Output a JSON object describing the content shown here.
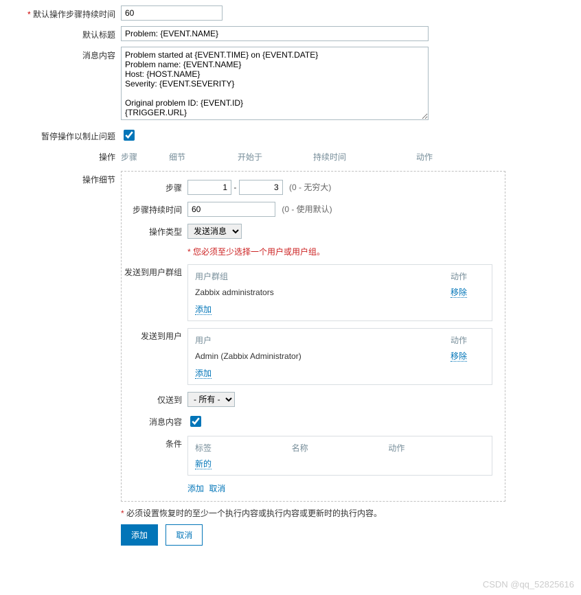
{
  "form": {
    "default_duration": {
      "label": "默认操作步骤持续时间",
      "value": "60"
    },
    "default_title": {
      "label": "默认标题",
      "value": "Problem: {EVENT.NAME}"
    },
    "message": {
      "label": "消息内容",
      "value": "Problem started at {EVENT.TIME} on {EVENT.DATE}\nProblem name: {EVENT.NAME}\nHost: {HOST.NAME}\nSeverity: {EVENT.SEVERITY}\n\nOriginal problem ID: {EVENT.ID}\n{TRIGGER.URL}"
    },
    "pause": {
      "label": "暂停操作以制止问题",
      "checked": true
    },
    "operations": {
      "label": "操作",
      "headers": {
        "step": "步骤",
        "detail": "细节",
        "start": "开始于",
        "duration": "持续时间",
        "action": "动作"
      }
    }
  },
  "details": {
    "label": "操作细节",
    "steps": {
      "label": "步骤",
      "from": "1",
      "to": "3",
      "hint": "(0 - 无穷大)"
    },
    "step_duration": {
      "label": "步骤持续时间",
      "value": "60",
      "hint": "(0 - 使用默认)"
    },
    "op_type": {
      "label": "操作类型",
      "value": "发送消息"
    },
    "validation": "您必须至少选择一个用户或用户组。",
    "user_groups": {
      "label": "发送到用户群组",
      "header_name": "用户群组",
      "header_action": "动作",
      "rows": [
        {
          "name": "Zabbix administrators",
          "action": "移除"
        }
      ],
      "add": "添加"
    },
    "users": {
      "label": "发送到用户",
      "header_name": "用户",
      "header_action": "动作",
      "rows": [
        {
          "name": "Admin (Zabbix Administrator)",
          "action": "移除"
        }
      ],
      "add": "添加"
    },
    "send_only": {
      "label": "仅送到",
      "value": "- 所有 -"
    },
    "msg_content": {
      "label": "消息内容",
      "checked": true
    },
    "conditions": {
      "label": "条件",
      "header_tag": "标签",
      "header_name": "名称",
      "header_action": "动作",
      "new": "新的"
    },
    "footer": {
      "add": "添加",
      "cancel": "取消"
    }
  },
  "recovery_note": "必须设置恢复时的至少一个执行内容或执行内容或更新时的执行内容。",
  "buttons": {
    "add": "添加",
    "cancel": "取消"
  },
  "watermark": "CSDN @qq_52825616"
}
